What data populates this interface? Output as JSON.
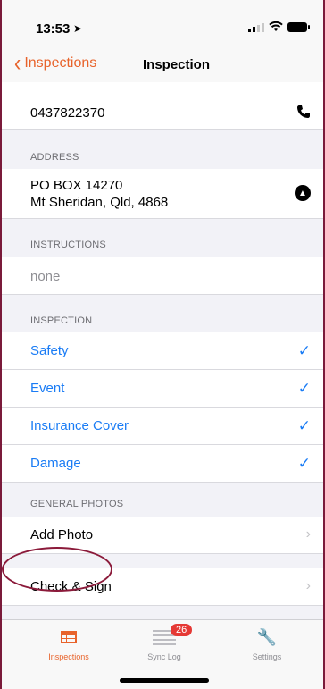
{
  "status_bar": {
    "time": "13:53",
    "location_glyph": "➤"
  },
  "nav": {
    "back_label": "Inspections",
    "title": "Inspection"
  },
  "phone": "0437822370",
  "address": {
    "header": "ADDRESS",
    "line1": "PO BOX 14270",
    "line2": "Mt Sheridan, Qld, 4868",
    "nav_glyph": "▲"
  },
  "instructions": {
    "header": "INSTRUCTIONS",
    "value": "none"
  },
  "inspection": {
    "header": "INSPECTION",
    "items": [
      {
        "label": "Safety",
        "check": "✓"
      },
      {
        "label": "Event",
        "check": "✓"
      },
      {
        "label": "Insurance Cover",
        "check": "✓"
      },
      {
        "label": "Damage",
        "check": "✓"
      }
    ]
  },
  "photos": {
    "header": "GENERAL PHOTOS",
    "add_label": "Add Photo"
  },
  "check_sign": {
    "label": "Check & Sign"
  },
  "chevron": "›",
  "tabs": [
    {
      "label": "Inspections",
      "active_color": "#e8632b"
    },
    {
      "label": "Sync Log",
      "badge": "26"
    },
    {
      "label": "Settings",
      "glyph": "🔧"
    }
  ],
  "colors": {
    "accent": "#e8632b",
    "link": "#1a7cf5",
    "annotation": "#8b1a3a"
  }
}
